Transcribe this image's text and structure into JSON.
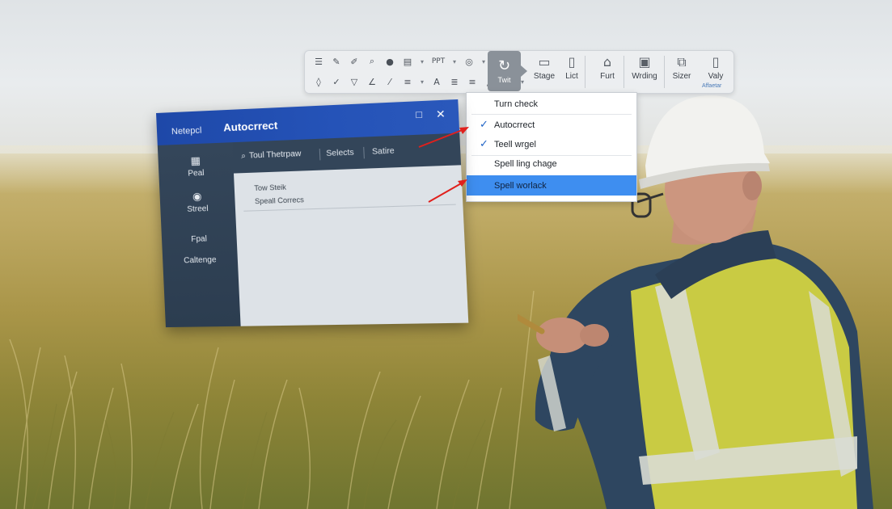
{
  "toolbar": {
    "row1_ppt": "PPT",
    "active_label": "Twit",
    "buttons": [
      "Stage",
      "Lict",
      "Furt",
      "Wrding",
      "Sizer",
      "Valy"
    ],
    "valy_sub": "Affaetar"
  },
  "dropdown": {
    "items": [
      {
        "label": "Turn check",
        "checked": false,
        "selected": false
      },
      {
        "label": "Autocrrect",
        "checked": true,
        "selected": false
      },
      {
        "label": "Teell wrgel",
        "checked": true,
        "selected": false
      },
      {
        "label": "Spell ling chage",
        "checked": false,
        "selected": false
      },
      {
        "label": "Spell worlack",
        "checked": false,
        "selected": true
      }
    ]
  },
  "window": {
    "app_name": "Netepcl",
    "title": "Autocrrect",
    "search_text": "Toul Thetrpaw",
    "tabs": [
      "Selects",
      "Satire"
    ],
    "sidebar": [
      "Peal",
      "Streel",
      "Fpal",
      "Caltenge"
    ],
    "rows": [
      "Tow Steik",
      "Speall Correcs"
    ]
  },
  "colors": {
    "title_bar": "#1e48a8",
    "sidebar": "#2c3d50",
    "selection": "#3e8ef0",
    "check": "#1f63c6",
    "arrow": "#e0201c"
  }
}
